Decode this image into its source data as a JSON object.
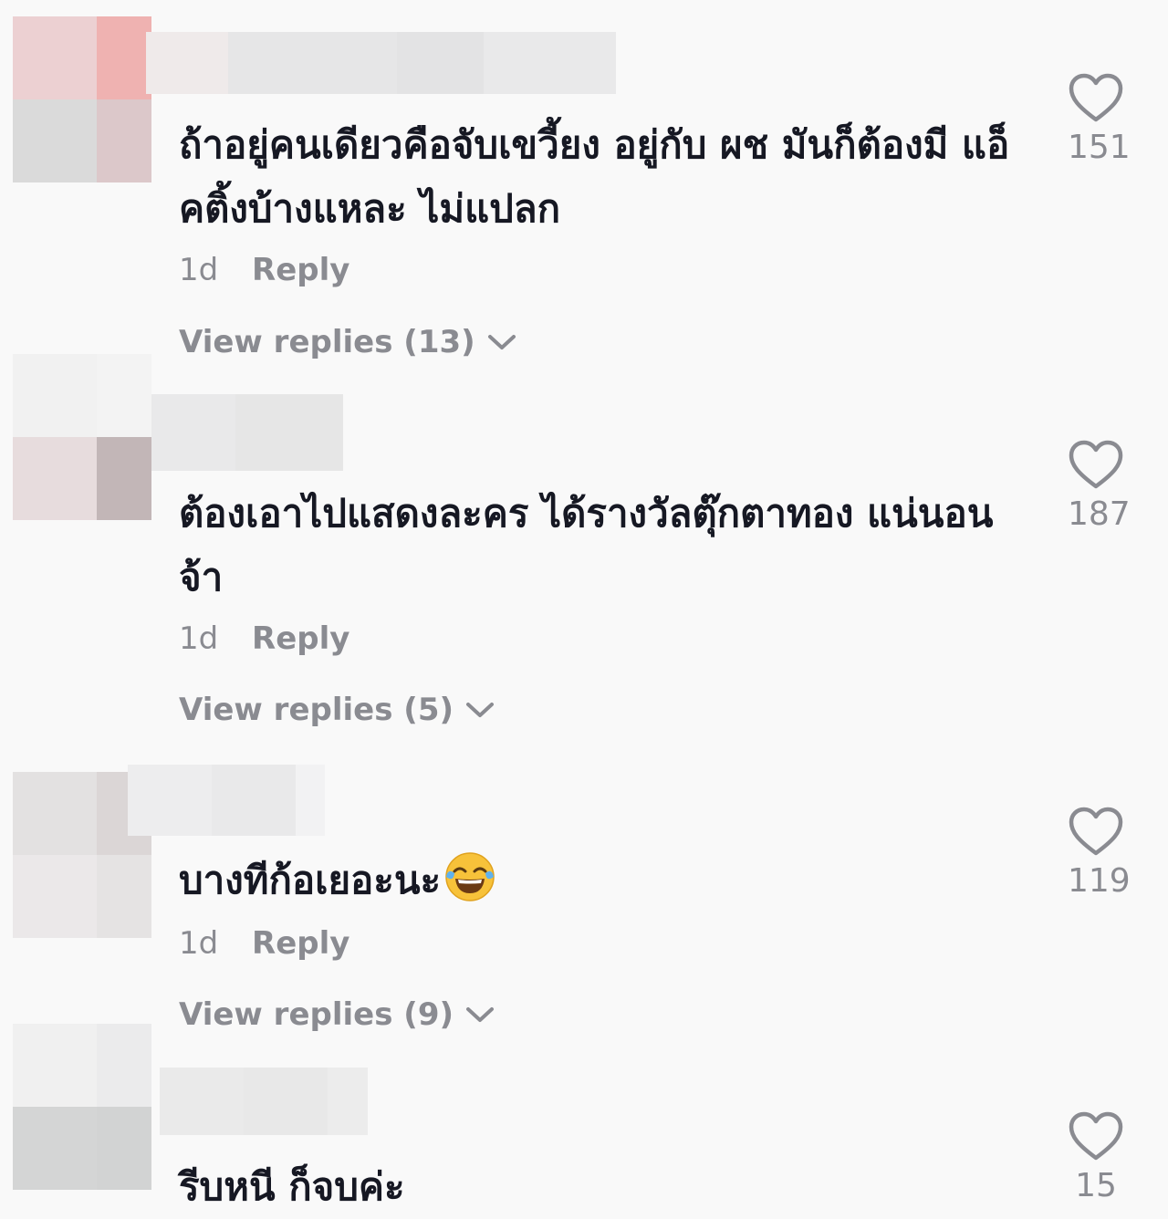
{
  "comments": [
    {
      "text": "ถ้าอยู่คนเดียวคือจับเขวี้ยง อยู่กับ ผช มันก็ต้องมี แอ็คติ้งบ้างแหละ ไม่แปลก",
      "time": "1d",
      "reply_label": "Reply",
      "view_replies": "View replies (13)",
      "likes": "151"
    },
    {
      "text": "ต้องเอาไปแสดงละคร ได้รางวัลตุ๊กตาทอง แน่นอนจ้า",
      "time": "1d",
      "reply_label": "Reply",
      "view_replies": "View replies (5)",
      "likes": "187"
    },
    {
      "text": "บางทีก้อเยอะนะ",
      "emoji": "tears-of-joy",
      "time": "1d",
      "reply_label": "Reply",
      "view_replies": "View replies (9)",
      "likes": "119"
    },
    {
      "text": "รีบหนี ก็จบค่ะ",
      "likes": "15"
    }
  ],
  "colors": {
    "background": "#f9f9f9",
    "text": "#161823",
    "secondary": "#8a8b91"
  }
}
